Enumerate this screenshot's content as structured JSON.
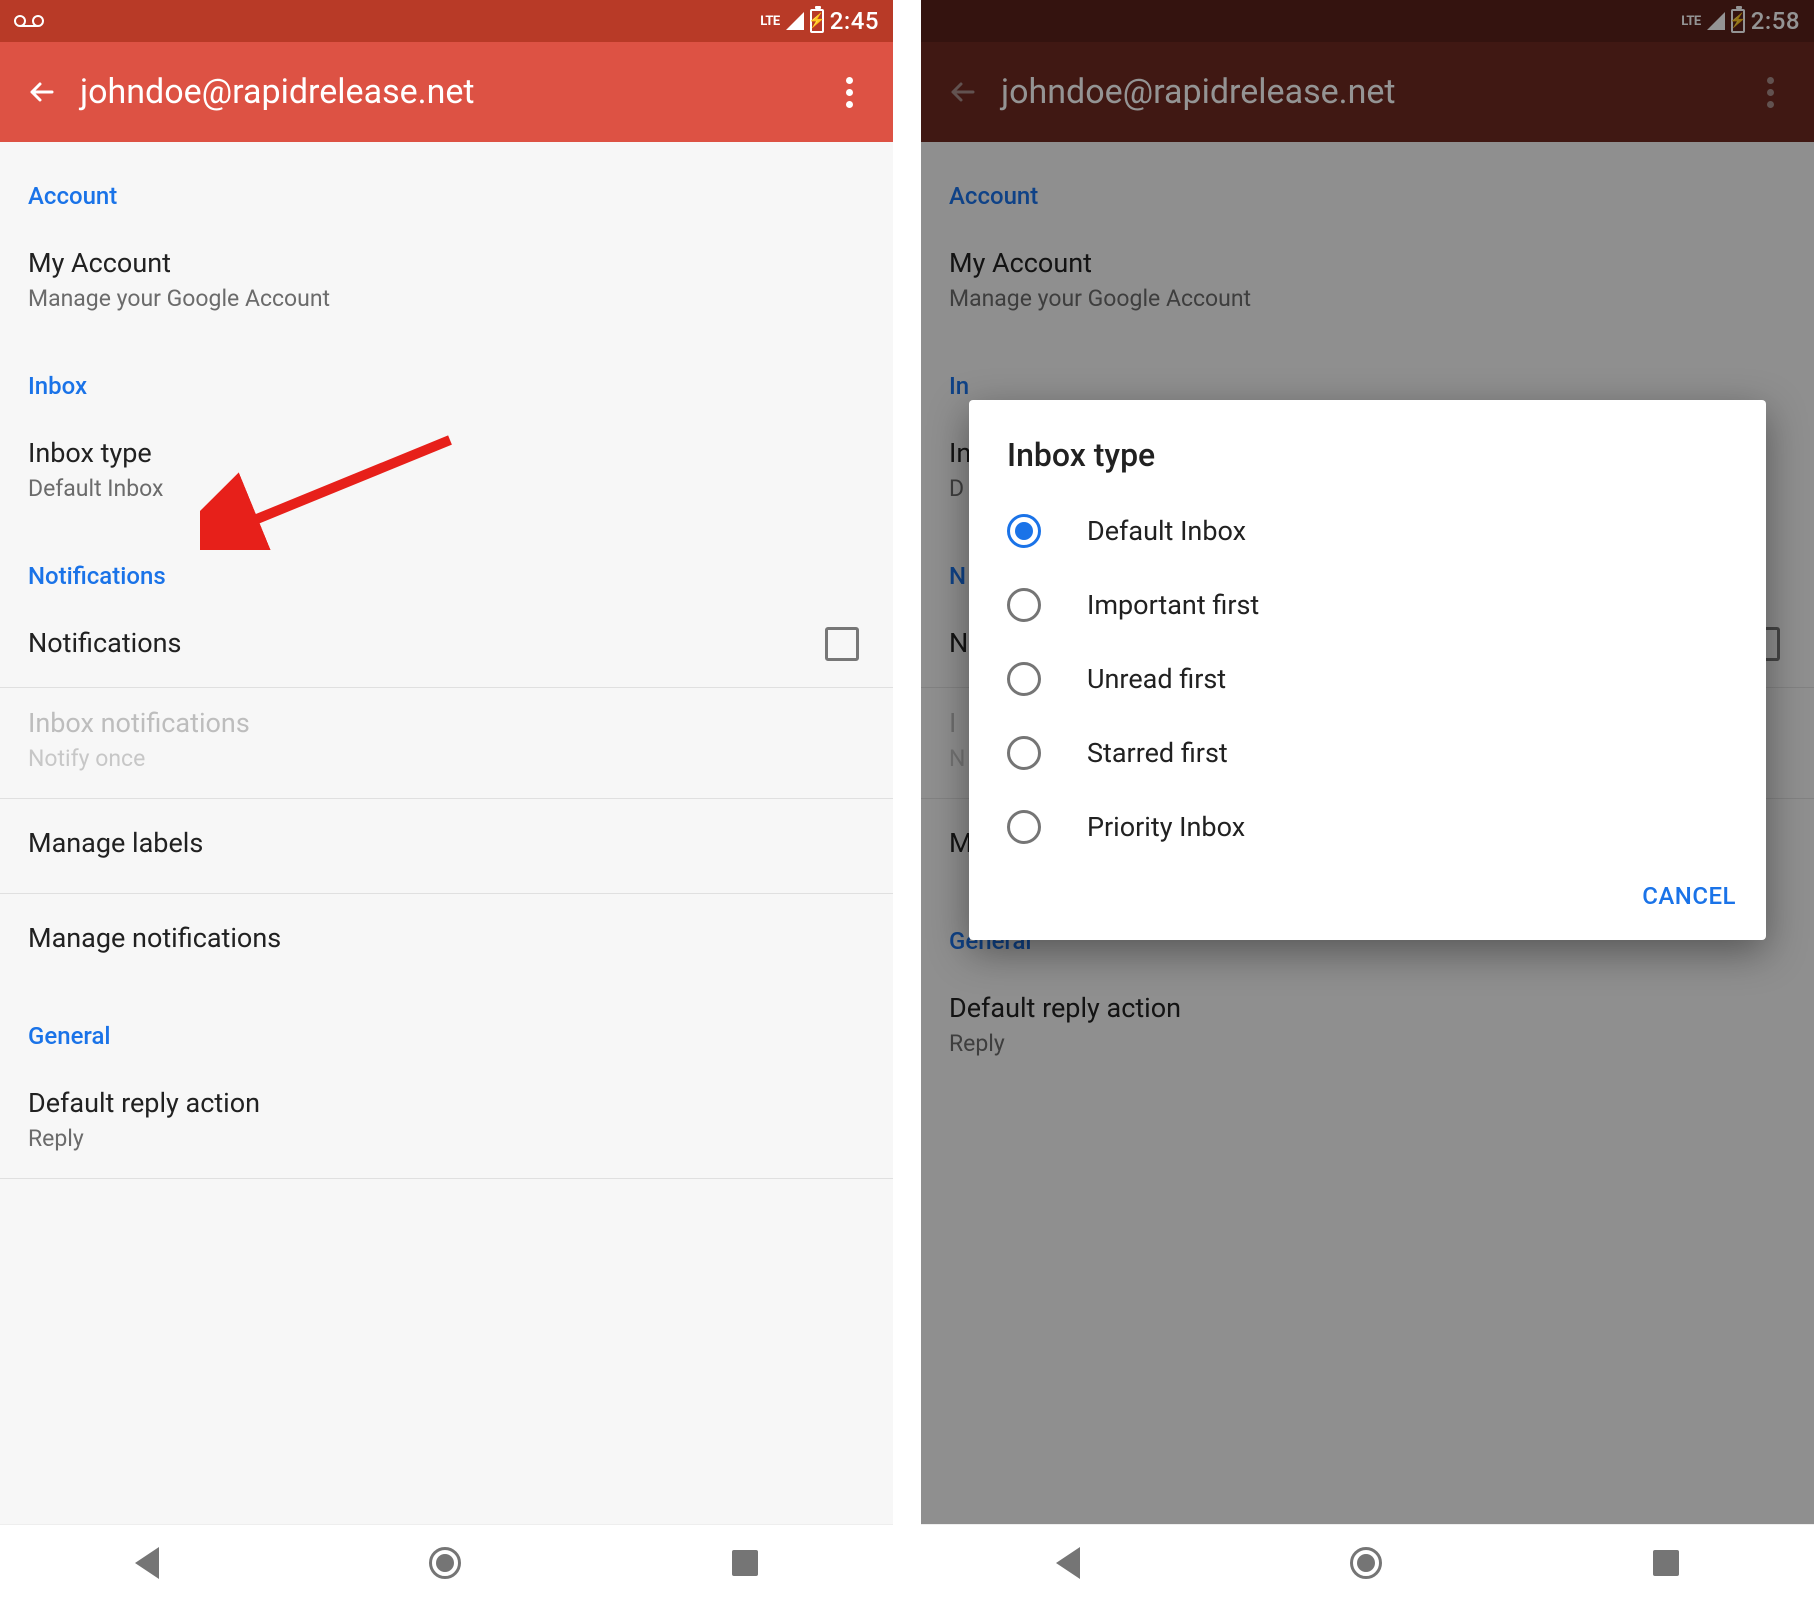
{
  "left": {
    "status": {
      "time": "2:45",
      "lte": "LTE"
    },
    "appbar": {
      "title": "johndoe@rapidrelease.net"
    },
    "sections": {
      "account": {
        "header": "Account",
        "my_account": {
          "title": "My Account",
          "sub": "Manage your Google Account"
        }
      },
      "inbox": {
        "header": "Inbox",
        "inbox_type": {
          "title": "Inbox type",
          "sub": "Default Inbox"
        }
      },
      "notifications": {
        "header": "Notifications",
        "notifications_row": "Notifications",
        "inbox_notifications": {
          "title": "Inbox notifications",
          "sub": "Notify once"
        },
        "manage_labels": "Manage labels",
        "manage_notifications": "Manage notifications"
      },
      "general": {
        "header": "General",
        "default_reply": {
          "title": "Default reply action",
          "sub": "Reply"
        }
      }
    }
  },
  "right": {
    "status": {
      "time": "2:58",
      "lte": "LTE"
    },
    "appbar": {
      "title": "johndoe@rapidrelease.net"
    },
    "sections": {
      "account": {
        "header": "Account",
        "my_account": {
          "title": "My Account",
          "sub": "Manage your Google Account"
        }
      },
      "inbox": {
        "header_initial": "In",
        "row_initials": {
          "t": "In",
          "s": "D"
        }
      },
      "notifications": {
        "header_initial": "N",
        "row_initial": "N",
        "inbox_notifs": {
          "t": "I",
          "s": "N"
        }
      },
      "manage_notifications": "Manage notifications",
      "general": {
        "header": "General",
        "default_reply": {
          "title": "Default reply action",
          "sub": "Reply"
        }
      }
    },
    "dialog": {
      "title": "Inbox type",
      "options": [
        "Default Inbox",
        "Important first",
        "Unread first",
        "Starred first",
        "Priority Inbox"
      ],
      "selected_index": 0,
      "cancel": "CANCEL"
    }
  }
}
